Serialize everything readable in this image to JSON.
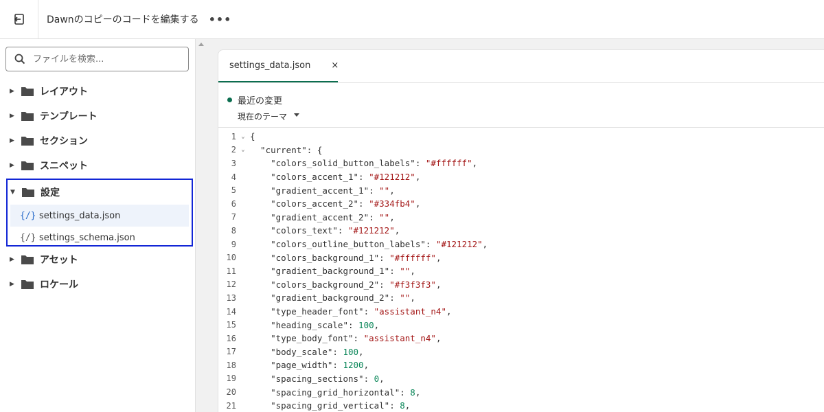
{
  "header": {
    "title": "Dawnのコピーのコードを編集する",
    "more": "•••"
  },
  "sidebar": {
    "search_placeholder": "ファイルを検索...",
    "folders": [
      {
        "label": "レイアウト"
      },
      {
        "label": "テンプレート"
      },
      {
        "label": "セクション"
      },
      {
        "label": "スニペット"
      },
      {
        "label": "設定"
      },
      {
        "label": "アセット"
      },
      {
        "label": "ロケール"
      }
    ],
    "settings_files": [
      {
        "label": "settings_data.json",
        "icon": "{/}"
      },
      {
        "label": "settings_schema.json",
        "icon": "{/}"
      }
    ]
  },
  "editor": {
    "tab_label": "settings_data.json",
    "tab_close": "×",
    "recent_changes": "最近の変更",
    "current_theme": "現在のテーマ",
    "lines": [
      {
        "n": "1",
        "fold": true,
        "html": "{"
      },
      {
        "n": "2",
        "fold": true,
        "key": "current",
        "indent": 1,
        "open": true
      },
      {
        "n": "3",
        "key": "colors_solid_button_labels",
        "str": "#ffffff"
      },
      {
        "n": "4",
        "key": "colors_accent_1",
        "str": "#121212"
      },
      {
        "n": "5",
        "key": "gradient_accent_1",
        "str": ""
      },
      {
        "n": "6",
        "key": "colors_accent_2",
        "str": "#334fb4"
      },
      {
        "n": "7",
        "key": "gradient_accent_2",
        "str": ""
      },
      {
        "n": "8",
        "key": "colors_text",
        "str": "#121212"
      },
      {
        "n": "9",
        "key": "colors_outline_button_labels",
        "str": "#121212"
      },
      {
        "n": "10",
        "key": "colors_background_1",
        "str": "#ffffff"
      },
      {
        "n": "11",
        "key": "gradient_background_1",
        "str": ""
      },
      {
        "n": "12",
        "key": "colors_background_2",
        "str": "#f3f3f3"
      },
      {
        "n": "13",
        "key": "gradient_background_2",
        "str": ""
      },
      {
        "n": "14",
        "key": "type_header_font",
        "str": "assistant_n4"
      },
      {
        "n": "15",
        "key": "heading_scale",
        "num": "100"
      },
      {
        "n": "16",
        "key": "type_body_font",
        "str": "assistant_n4"
      },
      {
        "n": "17",
        "key": "body_scale",
        "num": "100"
      },
      {
        "n": "18",
        "key": "page_width",
        "num": "1200"
      },
      {
        "n": "19",
        "key": "spacing_sections",
        "num": "0"
      },
      {
        "n": "20",
        "key": "spacing_grid_horizontal",
        "num": "8"
      },
      {
        "n": "21",
        "key": "spacing_grid_vertical",
        "num": "8"
      }
    ]
  },
  "colors": {
    "accent": "#0b6e4f",
    "highlight_border": "#1226d6",
    "string": "#a31515",
    "number": "#098658"
  }
}
